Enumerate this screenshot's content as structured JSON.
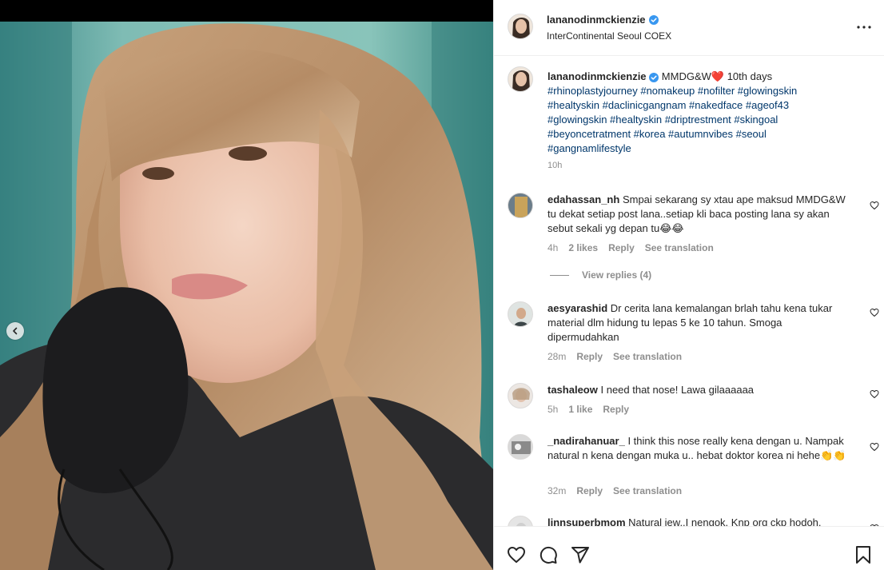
{
  "post": {
    "username": "lananodinmckienzie",
    "location": "InterContinental Seoul COEX",
    "caption_lead": "MMDG&W❤️ 10th days",
    "hashtags": "#rhinoplastyjourney #nomakeup #nofilter #glowingskin #healtyskin #daclinicgangnam #nakedface #ageof43 #glowingskin #healtyskin #driptrestment #skingoal #beyoncetratment #korea #autumnvibes #seoul #gangnamlifestyle",
    "time": "10h"
  },
  "comments": [
    {
      "username": "edahassan_nh",
      "text": "Smpai sekarang sy xtau ape maksud MMDG&W tu dekat setiap post lana..setiap kli baca posting lana sy akan sebut sekali yg depan tu😂😂",
      "time": "4h",
      "likes": "2 likes",
      "reply": "Reply",
      "translate": "See translation",
      "view_replies": "View replies (4)"
    },
    {
      "username": "aesyarashid",
      "text": "Dr cerita lana kemalangan brlah tahu kena tukar material dlm hidung tu lepas 5 ke 10 tahun. Smoga dipermudahkan",
      "time": "28m",
      "reply": "Reply",
      "translate": "See translation"
    },
    {
      "username": "tashaleow",
      "text": "I need that nose! Lawa gilaaaaaa",
      "time": "5h",
      "likes": "1 like",
      "reply": "Reply"
    },
    {
      "username": "_nadirahanuar_",
      "text": "I think this nose really kena dengan u. Nampak natural n kena dengan muka u.. hebat doktor korea ni hehe👏👏",
      "time": "32m",
      "reply": "Reply",
      "translate": "See translation"
    },
    {
      "username": "linnsuperbmom",
      "text": "Natural jew..I nengok. Knp org ckp hodoh."
    }
  ],
  "icons": {
    "verified": "verified-badge-icon",
    "more": "more-options-icon",
    "like": "heart-icon",
    "comment": "comment-icon",
    "share": "share-icon",
    "save": "bookmark-icon",
    "prev": "chevron-left-icon"
  },
  "colors": {
    "verified": "#3897f0",
    "hashtag": "#00376b",
    "muted": "#8e8e8e",
    "text": "#262626"
  }
}
